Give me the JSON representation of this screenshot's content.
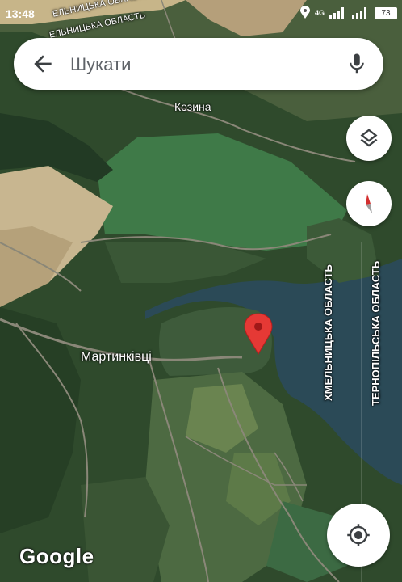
{
  "status_bar": {
    "time": "13:48",
    "network": "4G",
    "battery": "73"
  },
  "search": {
    "placeholder": "Шукати"
  },
  "map": {
    "labels": {
      "region_top": "ЕЛЬНИЦЬКА ОБЛАСТЬ",
      "region_top_2": "ЕЛЬНИЦЬКА ОБЛАСТЬ",
      "village_kozyna": "Козина",
      "village_martynkivtsi": "Мартинківці",
      "region_khmelnytska": "ХМЕЛЬНИЦЬКА ОБЛАСТЬ",
      "region_ternopilska": "ТЕРНОПІЛЬСЬКА ОБЛАСТЬ"
    },
    "logo": "Google"
  },
  "colors": {
    "pin": "#e53935",
    "compass_red": "#d32f2f",
    "water": "#2b4a57"
  },
  "icons": [
    "back-arrow-icon",
    "mic-icon",
    "layers-icon",
    "compass-icon",
    "my-location-icon",
    "location-pin-icon"
  ]
}
